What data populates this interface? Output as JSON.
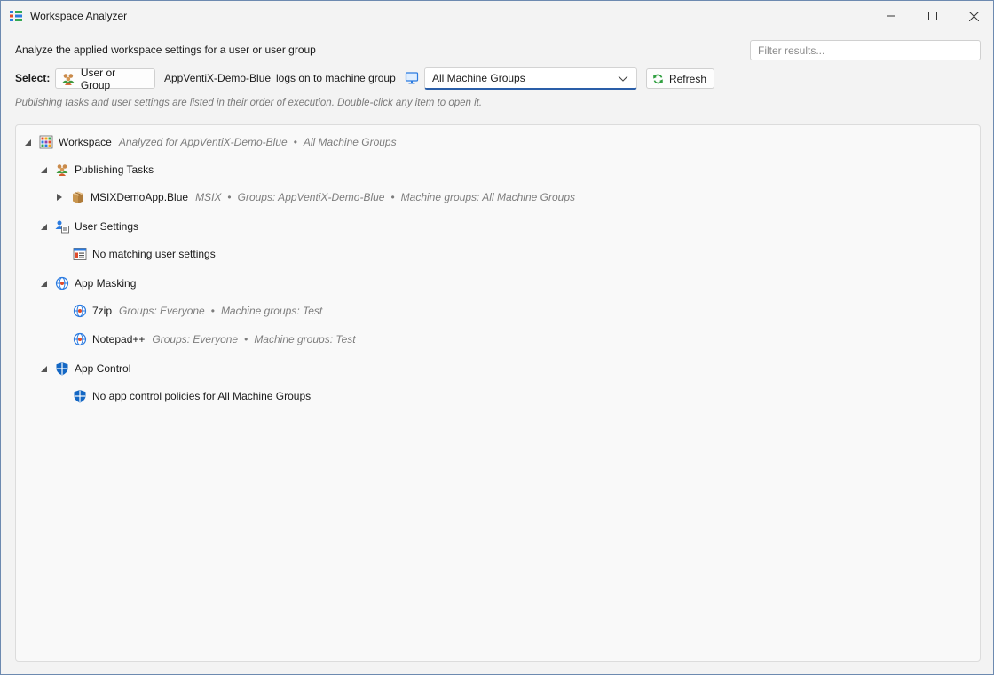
{
  "window": {
    "title": "Workspace Analyzer"
  },
  "header": {
    "description": "Analyze the applied workspace settings for a user or user group",
    "filter_placeholder": "Filter results...",
    "select_label": "Select:",
    "user_button_label": "User or Group",
    "selected_user": "AppVentiX-Demo-Blue",
    "logs_on_text": "logs on to machine group",
    "machine_group_value": "All Machine Groups",
    "refresh_label": "Refresh",
    "hint": "Publishing tasks and user settings are listed in their order of execution. Double-click any item to open it."
  },
  "tree": {
    "root": {
      "label": "Workspace",
      "meta_1": "Analyzed for AppVentiX-Demo-Blue",
      "meta_2": "All Machine Groups",
      "separator": "•"
    },
    "publishing": {
      "label": "Publishing Tasks",
      "item": {
        "label": "MSIXDemoApp.Blue",
        "meta_1": "MSIX",
        "meta_2": "Groups: AppVentiX-Demo-Blue",
        "meta_3": "Machine groups: All Machine Groups"
      }
    },
    "user_settings": {
      "label": "User Settings",
      "empty": "No matching user settings"
    },
    "app_masking": {
      "label": "App Masking",
      "items": [
        {
          "label": "7zip",
          "meta_1": "Groups: Everyone",
          "meta_2": "Machine groups: Test"
        },
        {
          "label": "Notepad++",
          "meta_1": "Groups: Everyone",
          "meta_2": "Machine groups: Test"
        }
      ]
    },
    "app_control": {
      "label": "App Control",
      "empty": "No app control policies for All Machine Groups"
    }
  },
  "icons": {
    "app": "app-logo-icon",
    "minimize": "minimize-icon",
    "maximize": "maximize-icon",
    "close": "close-icon",
    "user_group": "user-group-icon",
    "monitor": "monitor-icon",
    "refresh": "refresh-icon",
    "workspace": "workspace-grid-icon",
    "package": "package-icon",
    "user_settings": "user-settings-icon",
    "globe": "globe-icon",
    "shield": "shield-icon"
  },
  "colors": {
    "accent": "#2a5ea8",
    "meta_text": "#7d7d7d",
    "refresh_green": "#2e9e3e",
    "shield_blue": "#1467c4"
  }
}
